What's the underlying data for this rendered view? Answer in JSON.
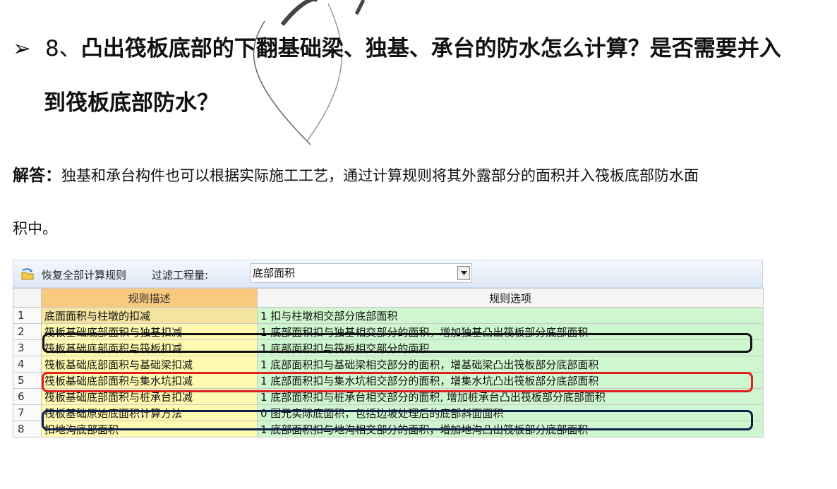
{
  "question": {
    "bullet": "➢",
    "number": "8、",
    "line1": "凸出筏板底部的下翻基础梁、独基、承台的防水怎么计算？是否需要并入",
    "line2": "到筏板底部防水？"
  },
  "answer": {
    "label": "解答：",
    "line1": "独基和承台构件也可以根据实际施工工艺，通过计算规则将其外露部分的面积并入筏板底部防水面",
    "line2": "积中。"
  },
  "toolbar": {
    "restore_label": "恢复全部计算规则",
    "filter_label": "过滤工程量:",
    "filter_value": "底部面积"
  },
  "table": {
    "headers": {
      "index": "",
      "description": "规则描述",
      "option": "规则选项"
    },
    "rows": [
      {
        "index": "1",
        "description": "底面面积与柱墩的扣减",
        "option": "1  扣与柱墩相交部分底部面积"
      },
      {
        "index": "2",
        "description": "筏板基础底部面积与独基扣减",
        "option": "1  底部面积扣与独基相交部分的面积，增加独基凸出筏板部分底部面积"
      },
      {
        "index": "3",
        "description": "筏板基础底部面积与筏板扣减",
        "option": "1  底部面积扣与筏板相交部分的面积"
      },
      {
        "index": "4",
        "description": "筏板基础底部面积与基础梁扣减",
        "option": "1  底部面积扣与基础梁相交部分的面积，增基础梁凸出筏板部分底部面积"
      },
      {
        "index": "5",
        "description": "筏板基础底部面积与集水坑扣减",
        "option": "1  底部面积扣与集水坑相交部分的面积，增集水坑凸出筏板部分底部面积"
      },
      {
        "index": "6",
        "description": "筏板基础底部面积与桩承台扣减",
        "option": "1  底部面积扣与桩承台相交部分的面积, 增加桩承台凸出筏板部分底部面积"
      },
      {
        "index": "7",
        "description": "筏板基础原始底面积计算方法",
        "option": "0  图元实际底面积，包括边坡处理后的底部斜面面积"
      },
      {
        "index": "8",
        "description": "扣地沟底部面积",
        "option": "1  底部面积扣与地沟相交部分的面积，增加地沟凸出筏板部分底部面积"
      }
    ]
  },
  "colors": {
    "header_highlight": "#f9c97f",
    "description_cell": "#fffab0",
    "option_cell": "#cff7cf",
    "highlight_black": "#111111",
    "highlight_red": "#e02020",
    "highlight_navy": "#10204a"
  }
}
